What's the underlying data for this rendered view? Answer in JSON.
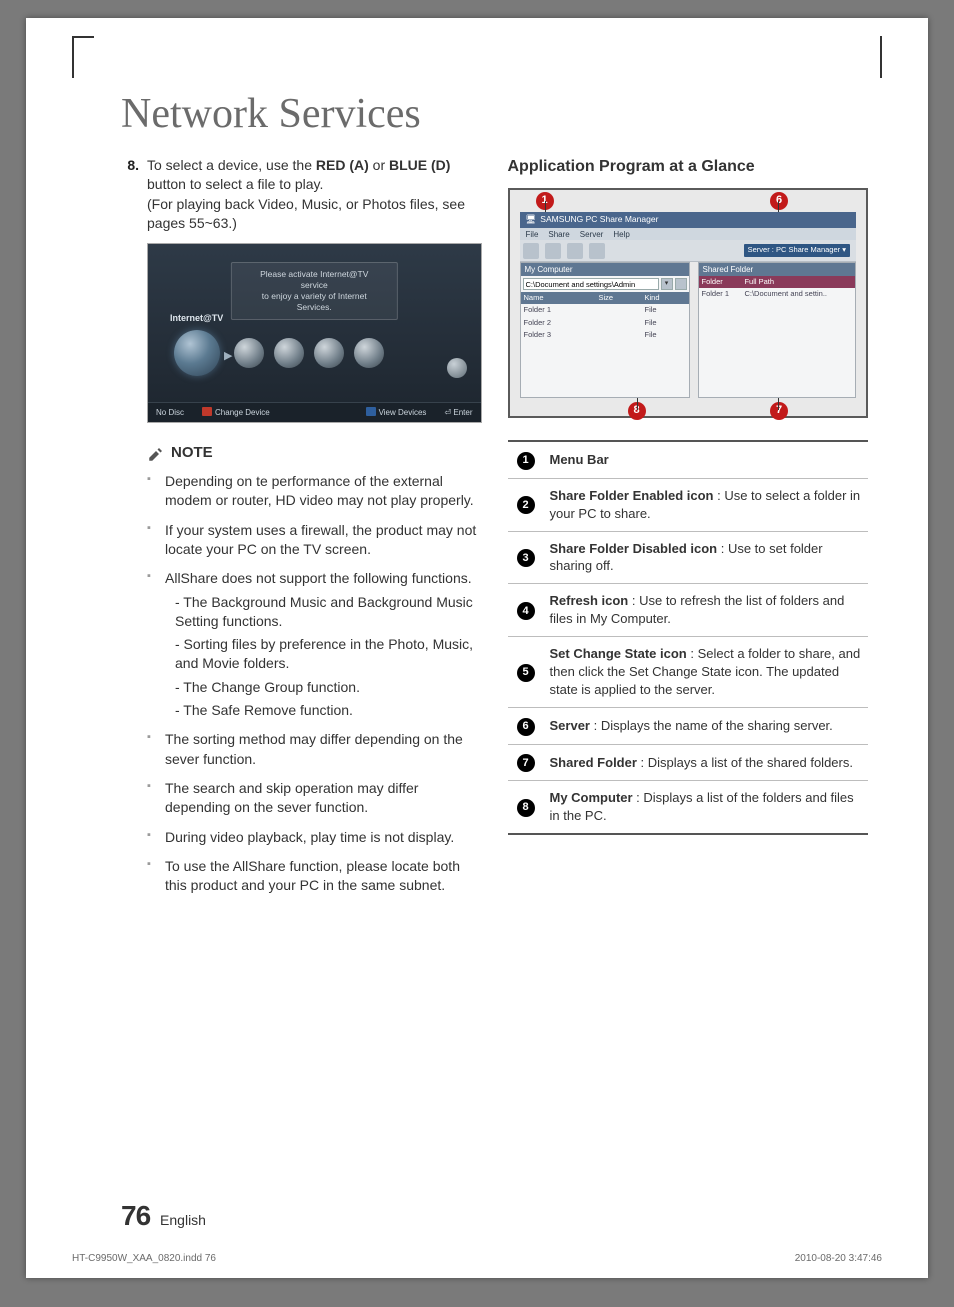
{
  "title": "Network Services",
  "step": {
    "num": "8.",
    "line1_a": "To select a device, use the ",
    "red": "RED (A)",
    "line1_b": " or ",
    "blue": "BLUE (D)",
    "line1_c": " button to select a file to play.",
    "line2": "(For playing back Video, Music, or Photos files, see pages 55~63.)"
  },
  "shot1": {
    "banner1": "Please activate Internet@TV service",
    "banner2": "to enjoy a variety of Internet Services.",
    "label": "Internet@TV",
    "bar_nodisc": "No Disc",
    "bar_change": "Change Device",
    "bar_view": "View Devices",
    "bar_enter": "Enter"
  },
  "note_label": "NOTE",
  "notes": {
    "n1": "Depending on te performance of the external modem or router, HD video may not play properly.",
    "n2": "If your system uses a firewall, the product may not locate your PC on the TV screen.",
    "n3": "AllShare does not support the following functions.",
    "n3a": "- The Background Music and Background Music Setting functions.",
    "n3b": "- Sorting files by preference in the Photo, Music, and Movie folders.",
    "n3c": "- The Change Group function.",
    "n3d": "- The Safe Remove function.",
    "n4": "The sorting method may differ depending on the sever function.",
    "n5": "The search and skip operation may differ depending on the sever function.",
    "n6": "During video playback, play time is not display.",
    "n7": "To use the AllShare function, please locate both this product and your PC in the same subnet."
  },
  "right_heading": "Application Program at a Glance",
  "shot2": {
    "title": "SAMSUNG PC Share Manager",
    "menu": [
      "File",
      "Share",
      "Server",
      "Help"
    ],
    "server_box": "Server : PC Share Manager ▾",
    "mycomputer": "My Computer",
    "path": "C:\\Document and settings\\Admin",
    "cols_left": [
      "Name",
      "Size",
      "Kind"
    ],
    "rows_left": [
      {
        "name": "Folder 1",
        "size": "",
        "kind": "File"
      },
      {
        "name": "Folder 2",
        "size": "",
        "kind": "File"
      },
      {
        "name": "Folder 3",
        "size": "",
        "kind": "File"
      }
    ],
    "shared": "Shared Folder",
    "cols_right": [
      "Folder",
      "Full Path"
    ],
    "rows_right": [
      {
        "folder": "Folder 1",
        "path": "C:\\Document and settin.."
      }
    ]
  },
  "glance": [
    {
      "n": "1",
      "title": "Menu Bar",
      "body": ""
    },
    {
      "n": "2",
      "title": "Share Folder Enabled icon",
      "body": " : Use to select a folder in your PC to share."
    },
    {
      "n": "3",
      "title": "Share Folder Disabled icon",
      "body": " : Use to set folder sharing off."
    },
    {
      "n": "4",
      "title": "Refresh icon",
      "body": " : Use to refresh the list of folders and files in My Computer."
    },
    {
      "n": "5",
      "title": "Set Change State icon",
      "body": " : Select a folder to share, and then click the Set Change State icon. The updated state is applied to the server."
    },
    {
      "n": "6",
      "title": "Server",
      "body": " : Displays the name of the sharing server."
    },
    {
      "n": "7",
      "title": "Shared Folder",
      "body": " : Displays a list of the shared folders."
    },
    {
      "n": "8",
      "title": "My Computer",
      "body": " : Displays a list of the folders and files in the PC."
    }
  ],
  "footer": {
    "page": "76",
    "lang": "English"
  },
  "meta": {
    "left": "HT-C9950W_XAA_0820.indd   76",
    "right": "2010-08-20   3:47:46"
  }
}
